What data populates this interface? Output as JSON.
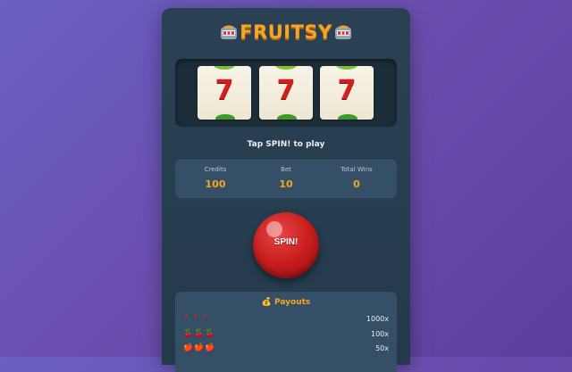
{
  "game": {
    "title": "FRUITSY",
    "status": "Tap SPIN! to play",
    "reels": [
      "7",
      "7",
      "7"
    ],
    "stats": [
      {
        "label": "Credits",
        "value": "100"
      },
      {
        "label": "Bet",
        "value": "10"
      },
      {
        "label": "Total Wins",
        "value": "0"
      }
    ],
    "spin_label": "SPIN!",
    "payouts": {
      "title": "💰 Payouts",
      "rows": [
        {
          "combo": "7 7 7",
          "multiplier": "1000x"
        },
        {
          "combo": "🍒🍒🍒",
          "multiplier": "100x"
        },
        {
          "combo": "🍎🍎🍎",
          "multiplier": "50x"
        }
      ]
    }
  },
  "colors": {
    "accent": "#f5a623",
    "spin_button": "#c81d1d",
    "panel": "#243a4c"
  }
}
